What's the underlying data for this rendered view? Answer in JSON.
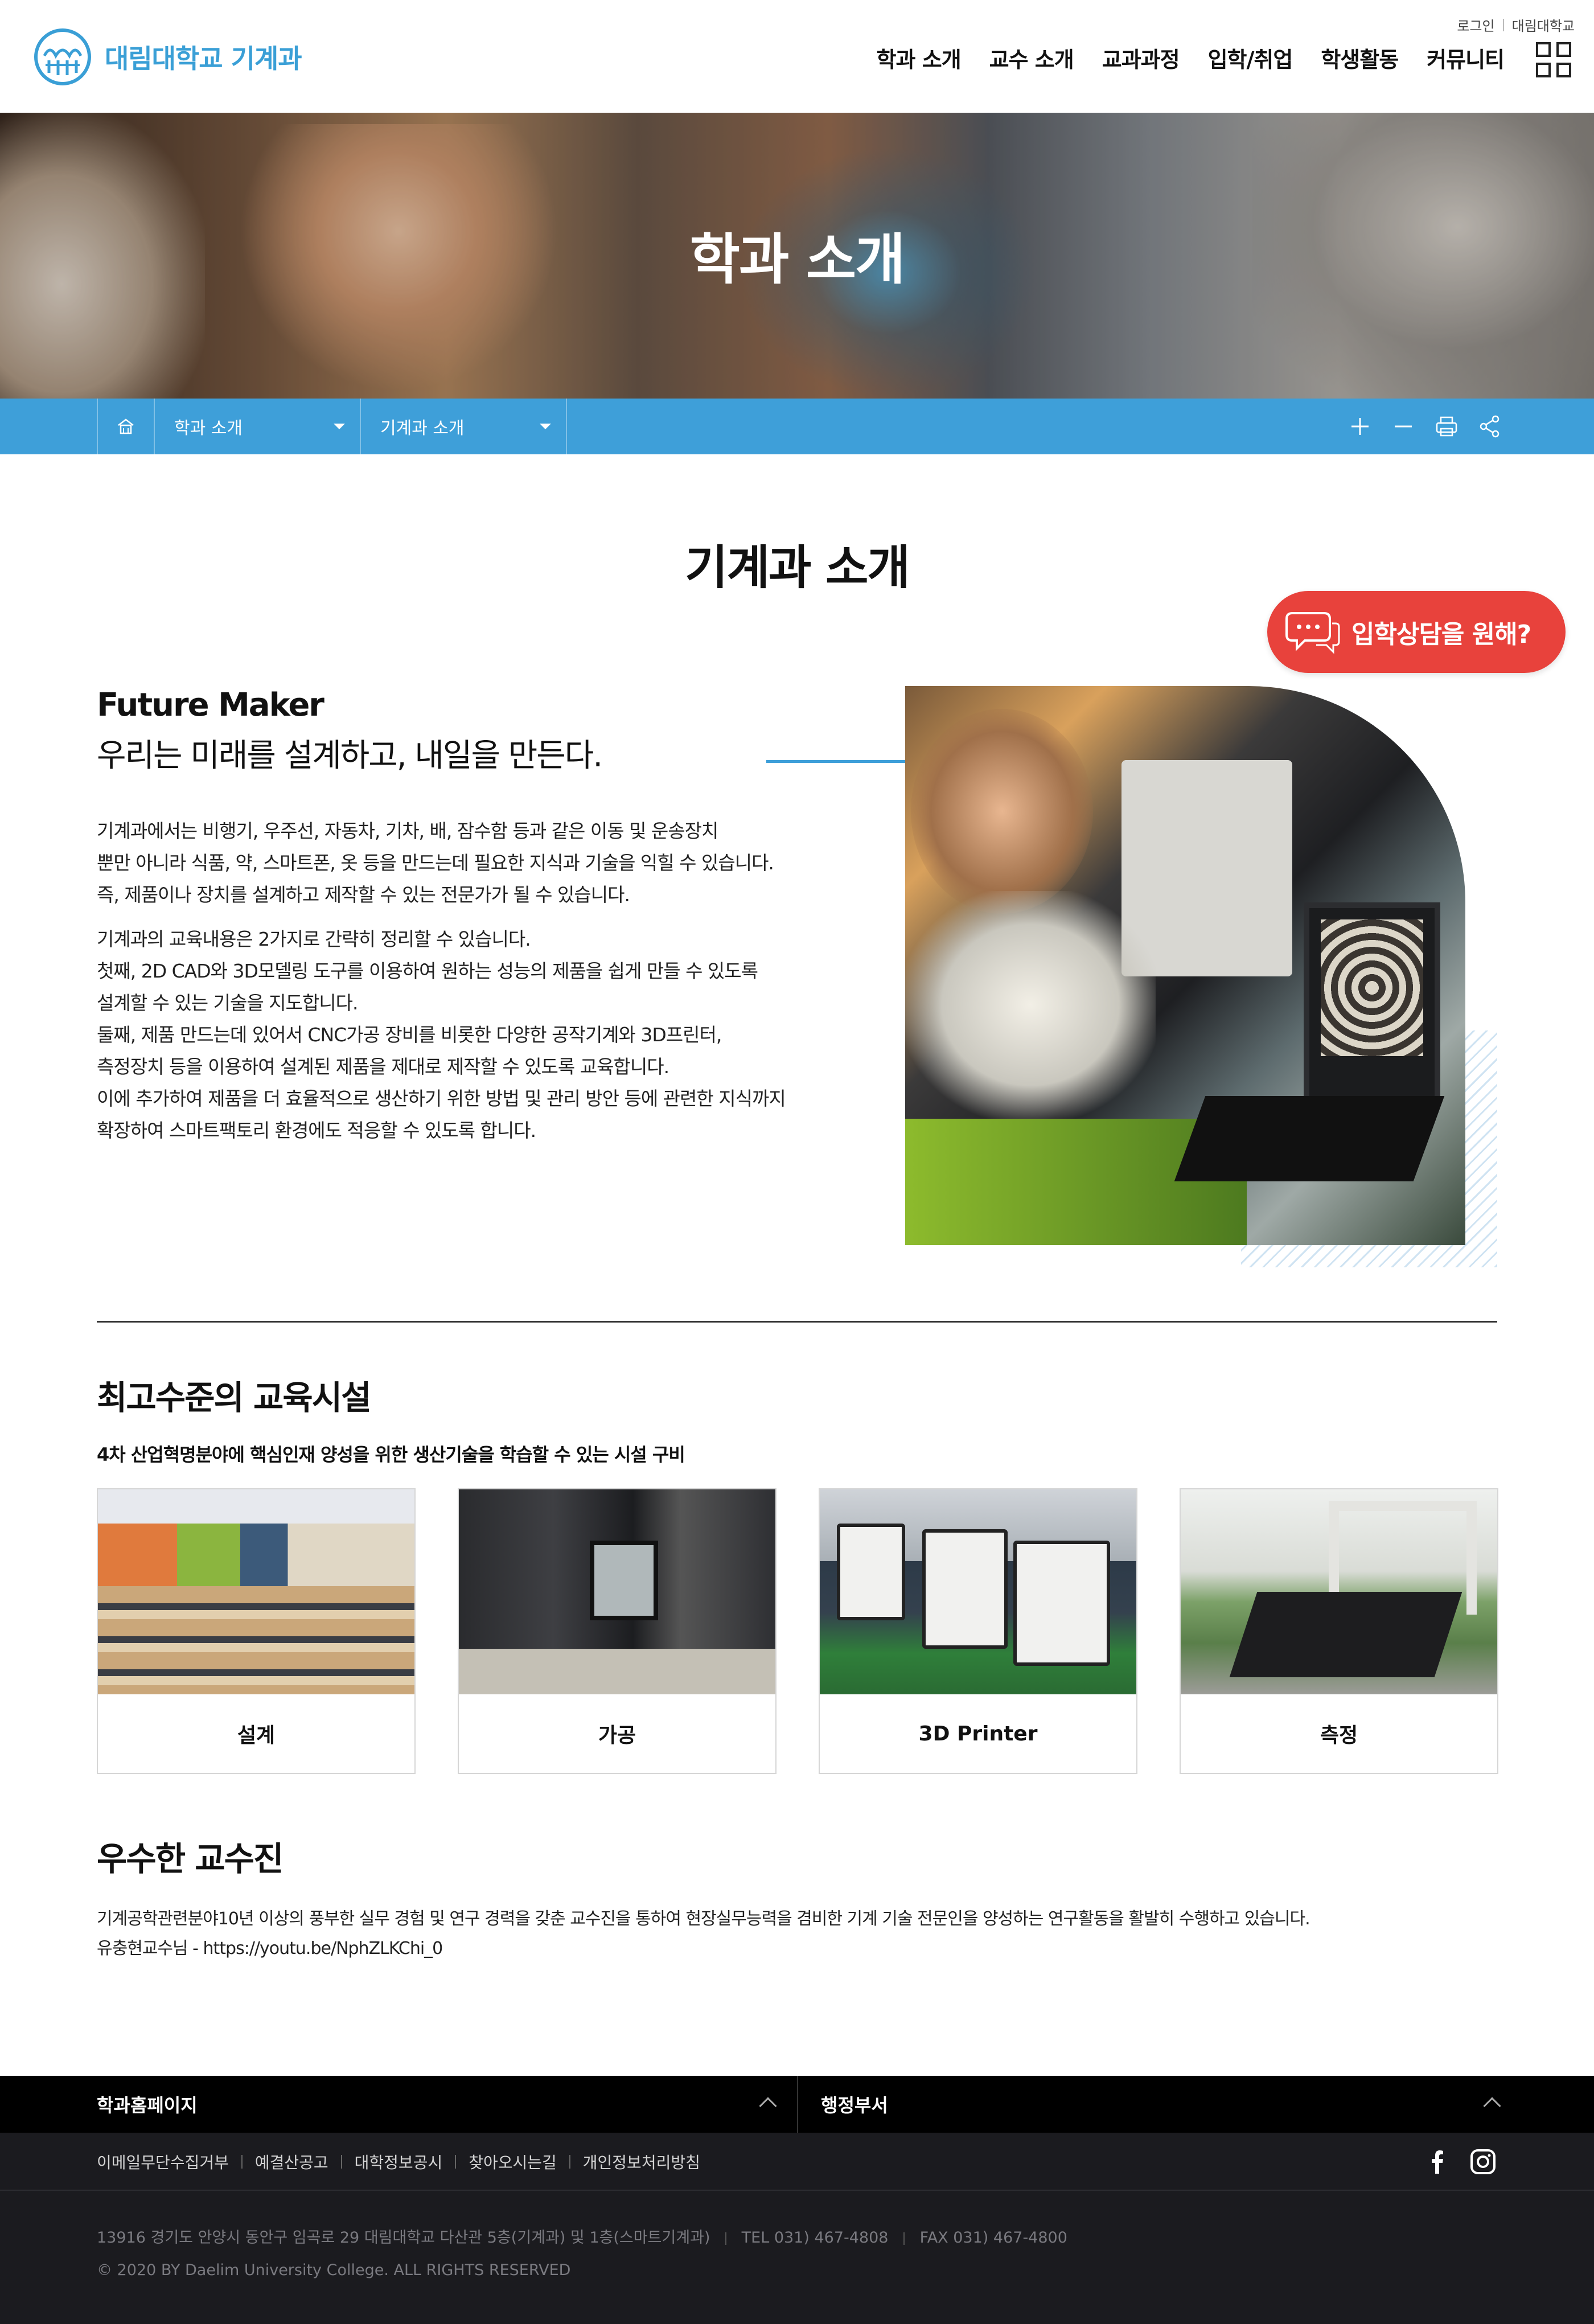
{
  "header": {
    "logo_text": "대림대학교 기계과",
    "utility": {
      "login": "로그인",
      "university": "대림대학교"
    },
    "nav": [
      "학과 소개",
      "교수 소개",
      "교과과정",
      "입학/취업",
      "학생활동",
      "커뮤니티"
    ]
  },
  "hero": {
    "title": "학과 소개"
  },
  "location": {
    "depth1": "학과 소개",
    "depth2": "기계과 소개"
  },
  "page": {
    "title": "기계과 소개"
  },
  "consult": {
    "label": "입학상담을 원해?"
  },
  "intro": {
    "heading_en": "Future Maker",
    "heading_ko": "우리는 미래를 설계하고, 내일을 만든다.",
    "para1": [
      "기계과에서는 비행기, 우주선, 자동차, 기차, 배, 잠수함 등과 같은 이동 및 운송장치",
      "뿐만 아니라 식품, 약, 스마트폰, 옷 등을 만드는데 필요한 지식과 기술을 익힐 수 있습니다.",
      "즉, 제품이나 장치를 설계하고 제작할 수 있는 전문가가 될 수 있습니다."
    ],
    "para2": [
      "기계과의 교육내용은 2가지로 간략히 정리할 수 있습니다.",
      "첫째, 2D CAD와 3D모델링 도구를 이용하여 원하는 성능의 제품을 쉽게 만들 수 있도록",
      "설계할 수 있는 기술을 지도합니다.",
      "둘째, 제품 만드는데 있어서 CNC가공 장비를 비롯한 다양한 공작기계와 3D프린터,",
      "측정장치 등을 이용하여 설계된 제품을 제대로 제작할 수 있도록 교육합니다.",
      "이에 추가하여 제품을 더 효율적으로 생산하기 위한 방법 및 관리 방안 등에 관련한 지식까지",
      "확장하여 스마트팩토리 환경에도 적응할 수 있도록 합니다."
    ]
  },
  "facilities": {
    "title": "최고수준의 교육시설",
    "subtitle": "4차 산업혁명분야에 핵심인재 양성을 위한 생산기술을 학습할 수 있는 시설 구비",
    "cards": [
      {
        "caption": "설계"
      },
      {
        "caption": "가공"
      },
      {
        "caption": "3D Printer"
      },
      {
        "caption": "측정"
      }
    ]
  },
  "faculty": {
    "title": "우수한 교수진",
    "text": "기계공학관련분야10년 이상의 풍부한 실무 경험 및 연구 경력을 갖춘 교수진을 통하여 현장실무능력을 겸비한 기계 기술 전문인을 양성하는 연구활동을 활발히 수행하고 있습니다.",
    "link": "유충현교수님 - https://youtu.be/NphZLKChi_0"
  },
  "footer": {
    "col1": "학과홈페이지",
    "col2": "행정부서",
    "links": [
      "이메일무단수집거부",
      "예결산공고",
      "대학정보공시",
      "찾아오시는길",
      "개인정보처리방침"
    ],
    "address": "13916 경기도 안양시 동안구 임곡로 29 대림대학교 다산관 5층(기계과) 및 1층(스마트기계과)",
    "tel": "TEL 031) 467-4808",
    "fax": "FAX 031) 467-4800",
    "copyright": "© 2020 BY Daelim University College. ALL RIGHTS RESERVED"
  },
  "colors": {
    "brand": "#3a9fd6",
    "locbar": "#3e9fd9",
    "consult": "#e8423c",
    "footer_dark": "#1b1b1f"
  },
  "icons": [
    "logo-mark-icon",
    "sitemap-icon",
    "home-icon",
    "plus-icon",
    "minus-icon",
    "print-icon",
    "share-icon",
    "chat-bubble-icon",
    "chevron-up-icon",
    "facebook-icon",
    "instagram-icon"
  ]
}
